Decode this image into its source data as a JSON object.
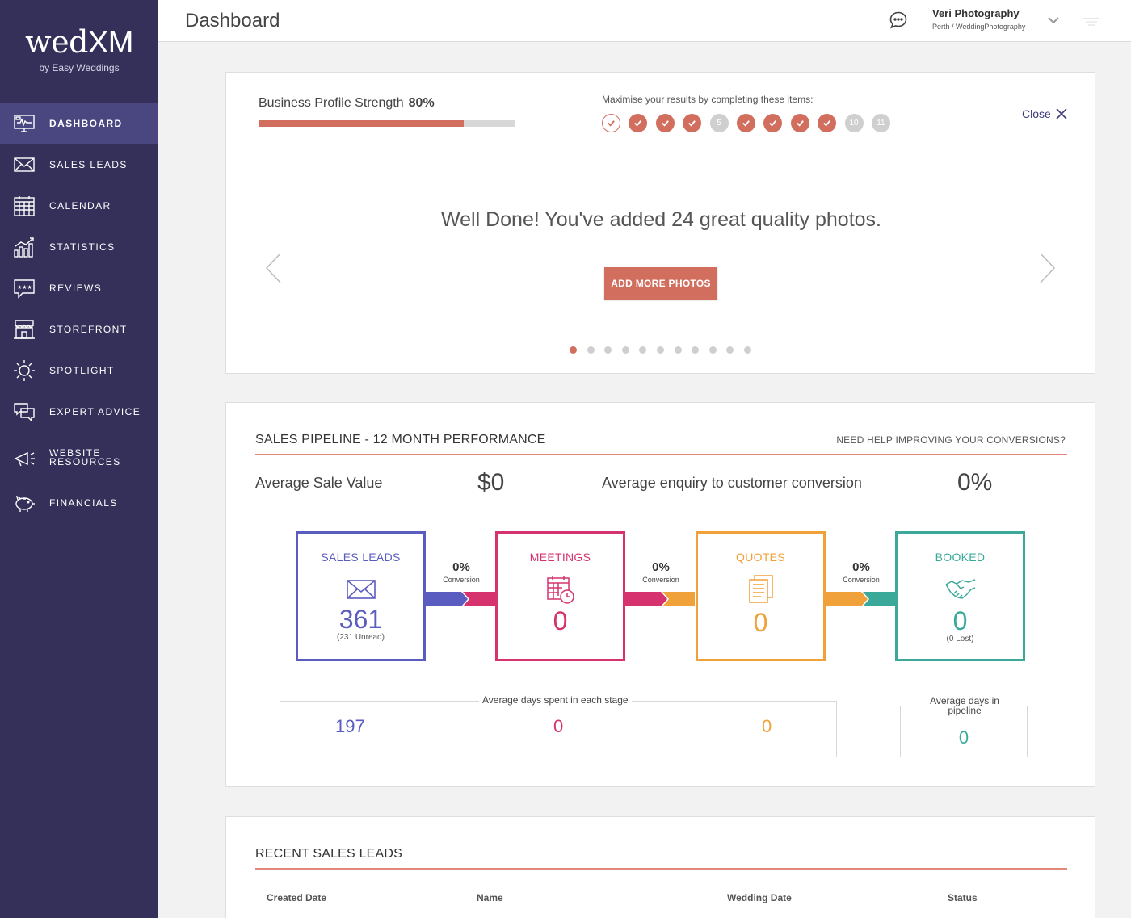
{
  "brand": {
    "logo_main": "wed",
    "logo_xm": "XM",
    "logo_sub": "by Easy Weddings"
  },
  "nav": [
    {
      "label": "DASHBOARD",
      "icon": "dashboard-icon",
      "active": true
    },
    {
      "label": "SALES LEADS",
      "icon": "envelope-icon"
    },
    {
      "label": "CALENDAR",
      "icon": "calendar-icon"
    },
    {
      "label": "STATISTICS",
      "icon": "statistics-icon"
    },
    {
      "label": "REVIEWS",
      "icon": "reviews-icon"
    },
    {
      "label": "STOREFRONT",
      "icon": "storefront-icon"
    },
    {
      "label": "SPOTLIGHT",
      "icon": "sun-icon"
    },
    {
      "label": "EXPERT ADVICE",
      "icon": "speech-bubbles-icon"
    },
    {
      "label": "WEBSITE RESOURCES",
      "icon": "megaphone-icon"
    },
    {
      "label": "FINANCIALS",
      "icon": "piggy-bank-icon"
    }
  ],
  "header": {
    "title": "Dashboard",
    "user_name": "Veri Photography",
    "user_location": "Perth / WeddingPhotography"
  },
  "profile": {
    "strength_label": "Business Profile Strength",
    "strength_value": "80%",
    "strength_fraction": 0.8,
    "maximise_label": "Maximise your results by completing these items:",
    "steps": [
      {
        "label": "",
        "state": "outline"
      },
      {
        "label": "",
        "state": "done"
      },
      {
        "label": "",
        "state": "done"
      },
      {
        "label": "",
        "state": "done"
      },
      {
        "label": "5",
        "state": "todo"
      },
      {
        "label": "",
        "state": "done"
      },
      {
        "label": "",
        "state": "done"
      },
      {
        "label": "",
        "state": "done"
      },
      {
        "label": "",
        "state": "done"
      },
      {
        "label": "10",
        "state": "todo"
      },
      {
        "label": "11",
        "state": "todo"
      }
    ],
    "close_label": "Close",
    "slide_message": "Well Done! You've added 24 great quality photos.",
    "slide_button": "ADD MORE PHOTOS",
    "slide_count": 11,
    "active_slide": 0
  },
  "pipeline": {
    "title": "SALES PIPELINE - 12 MONTH PERFORMANCE",
    "help_link": "NEED HELP IMPROVING YOUR CONVERSIONS?",
    "avg_sale_label": "Average Sale Value",
    "avg_sale_value": "$0",
    "avg_conv_label": "Average enquiry to customer conversion",
    "avg_conv_value": "0%",
    "stages": [
      {
        "title": "SALES LEADS",
        "count": "361",
        "sub": "(231 Unread)",
        "color": "#5a5dbf"
      },
      {
        "title": "MEETINGS",
        "count": "0",
        "sub": "",
        "color": "#d6336e"
      },
      {
        "title": "QUOTES",
        "count": "0",
        "sub": "",
        "color": "#f0a13a"
      },
      {
        "title": "BOOKED",
        "count": "0",
        "sub": "(0 Lost)",
        "color": "#3aa99a"
      }
    ],
    "conversions": [
      {
        "pct": "0%",
        "label": "Conversion"
      },
      {
        "pct": "0%",
        "label": "Conversion"
      },
      {
        "pct": "0%",
        "label": "Conversion"
      }
    ],
    "days_title": "Average days spent in each stage",
    "days_values": [
      "197",
      "0",
      "0"
    ],
    "pipeline_days_title": "Average days in pipeline",
    "pipeline_days_value": "0"
  },
  "recent": {
    "title": "RECENT SALES LEADS",
    "columns": [
      "Created Date",
      "Name",
      "Wedding Date",
      "Status"
    ]
  }
}
